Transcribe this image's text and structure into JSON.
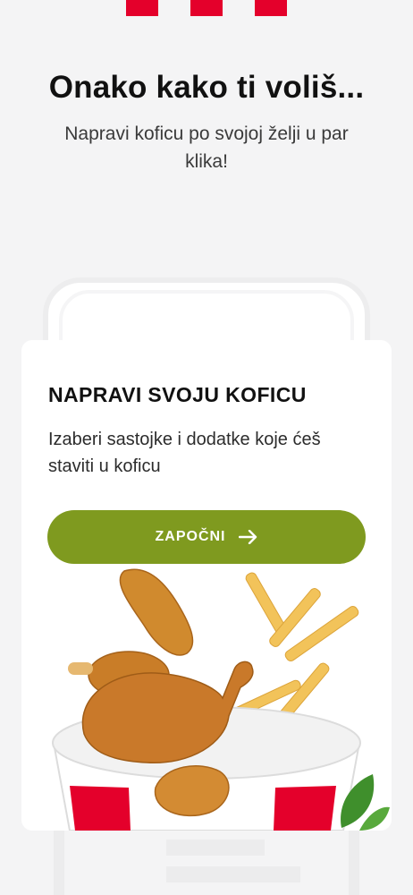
{
  "brand": {
    "stripe_color": "#e4002b",
    "logo_name": "kfc-stripes-logo"
  },
  "hero": {
    "headline": "Onako kako ti voliš...",
    "subtitle": "Napravi koficu po svojoj želji u par klika!"
  },
  "builder_card": {
    "title": "NAPRAVI SVOJU KOFICU",
    "description": "Izaberi sastojke i dodatke koje ćeš staviti u koficu",
    "cta_label": "ZAPOČNI",
    "cta_icon": "arrow-right-icon",
    "cta_color": "#7f9a1f",
    "image_name": "chicken-bucket-image"
  }
}
